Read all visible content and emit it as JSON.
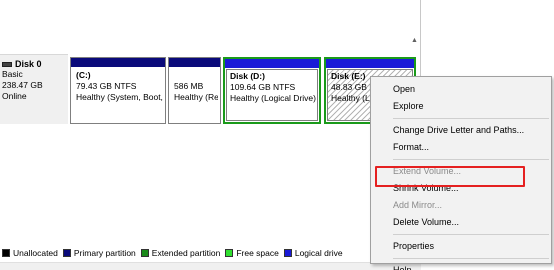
{
  "disk": {
    "name": "Disk 0",
    "type": "Basic",
    "size": "238.47 GB",
    "status": "Online"
  },
  "partitions": [
    {
      "name": "(C:)",
      "size_fs": "79.43 GB NTFS",
      "status": "Healthy (System, Boot,",
      "bar_color": "#0a0a7a"
    },
    {
      "name": "",
      "size_fs": "586 MB",
      "status": "Healthy (Re",
      "bar_color": "#0a0a7a"
    },
    {
      "name": "Disk  (D:)",
      "size_fs": "109.64 GB NTFS",
      "status": "Healthy (Logical Drive)",
      "bar_color": "#1a1ad8"
    },
    {
      "name": "Disk  (E:)",
      "size_fs": "48.83 GB N",
      "status": "Healthy (L",
      "bar_color": "#1a1ad8"
    }
  ],
  "legend": [
    {
      "label": "Unallocated",
      "color": "#000000"
    },
    {
      "label": "Primary partition",
      "color": "#0a0a7a"
    },
    {
      "label": "Extended partition",
      "color": "#1a8a1a"
    },
    {
      "label": "Free space",
      "color": "#30e030"
    },
    {
      "label": "Logical drive",
      "color": "#1a1ad8"
    }
  ],
  "context_menu": {
    "open": "Open",
    "explore": "Explore",
    "change_letter": "Change Drive Letter and Paths...",
    "format": "Format...",
    "extend": "Extend Volume...",
    "shrink": "Shrink Volume...",
    "add_mirror": "Add Mirror...",
    "delete": "Delete Volume...",
    "properties": "Properties",
    "help": "Help"
  },
  "colors": {
    "highlight_box": "#e52020",
    "selected_border": "#1a9a1a"
  }
}
